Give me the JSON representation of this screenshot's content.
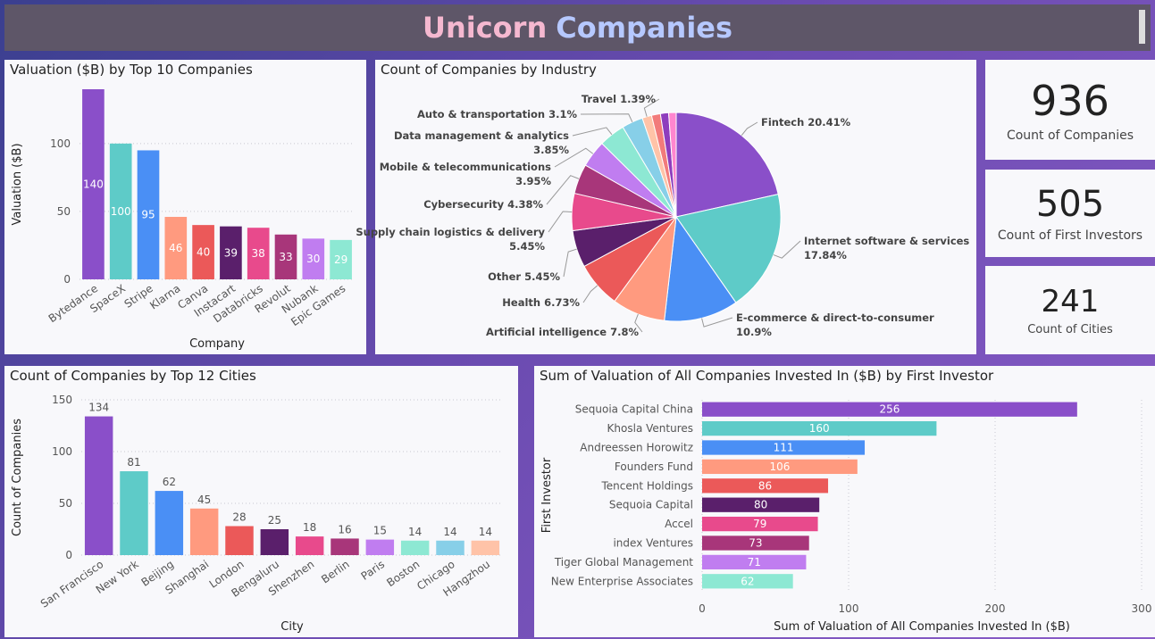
{
  "header": {
    "title_part1": "Unicorn",
    "title_part2": "Companies"
  },
  "kpis": [
    {
      "value": "936",
      "label": "Count of Companies"
    },
    {
      "value": "505",
      "label": "Count of First Investors"
    },
    {
      "value": "241",
      "label": "Count of Cities"
    }
  ],
  "chart_data": [
    {
      "type": "bar",
      "title": "Valuation ($B) by Top 10 Companies",
      "xlabel": "Company",
      "ylabel": "Valuation ($B)",
      "ylim": [
        0,
        140
      ],
      "yticks": [
        0,
        50,
        100
      ],
      "categories": [
        "Bytedance",
        "SpaceX",
        "Stripe",
        "Klarna",
        "Canva",
        "Instacart",
        "Databricks",
        "Revolut",
        "Nubank",
        "Epic Games"
      ],
      "values": [
        140,
        100,
        95,
        46,
        40,
        39,
        38,
        33,
        30,
        29
      ],
      "colors": [
        "#8a4fc9",
        "#5ecbc8",
        "#4a8ff5",
        "#ff9a7f",
        "#eb5959",
        "#5a1f6b",
        "#e84a8c",
        "#a8367a",
        "#c07df0",
        "#8de8d3"
      ],
      "grid": true
    },
    {
      "type": "pie",
      "title": "Count of Companies by Industry",
      "labels": [
        "Fintech 20.41%",
        "Internet software & services 17.84%",
        "E-commerce & direct-to-consumer 10.9%",
        "Artificial intelligence 7.8%",
        "Health 6.73%",
        "Other 5.45%",
        "Supply chain logistics & delivery 5.45%",
        "Cybersecurity 4.38%",
        "Mobile & telecommunications 3.95%",
        "Data management & analytics 3.85%",
        "Auto & transportation 3.1%",
        "Travel 1.39%"
      ],
      "values": [
        20.41,
        17.84,
        10.9,
        7.8,
        6.73,
        5.45,
        5.45,
        4.38,
        3.95,
        3.85,
        3.1,
        1.39,
        1.3,
        1.2,
        1.1
      ],
      "colors": [
        "#8a4fc9",
        "#5ecbc8",
        "#4a8ff5",
        "#ff9a7f",
        "#eb5959",
        "#5a1f6b",
        "#e84a8c",
        "#a8367a",
        "#c07df0",
        "#8de8d3",
        "#87cfe8",
        "#ffc3a8",
        "#f27b7b",
        "#8e3dbd",
        "#ff86cf"
      ]
    },
    {
      "type": "bar",
      "title": "Count of Companies by Top 12 Cities",
      "xlabel": "City",
      "ylabel": "Count of Companies",
      "ylim": [
        0,
        150
      ],
      "yticks": [
        0,
        50,
        100,
        150
      ],
      "categories": [
        "San Francisco",
        "New York",
        "Beijing",
        "Shanghai",
        "London",
        "Bengaluru",
        "Shenzhen",
        "Berlin",
        "Paris",
        "Boston",
        "Chicago",
        "Hangzhou"
      ],
      "values": [
        134,
        81,
        62,
        45,
        28,
        25,
        18,
        16,
        15,
        14,
        14,
        14
      ],
      "colors": [
        "#8a4fc9",
        "#5ecbc8",
        "#4a8ff5",
        "#ff9a7f",
        "#eb5959",
        "#5a1f6b",
        "#e84a8c",
        "#a8367a",
        "#c07df0",
        "#8de8d3",
        "#87cfe8",
        "#ffc3a8"
      ],
      "grid": true
    },
    {
      "type": "bar",
      "orientation": "horizontal",
      "title": "Sum of Valuation of All Companies Invested In ($B) by First Investor",
      "xlabel": "Sum of Valuation of All Companies Invested In ($B)",
      "ylabel": "First Investor",
      "xlim": [
        0,
        300
      ],
      "xticks": [
        0,
        100,
        200,
        300
      ],
      "categories": [
        "Sequoia Capital China",
        "Khosla Ventures",
        "Andreessen Horowitz",
        "Founders Fund",
        "Tencent Holdings",
        "Sequoia Capital",
        "Accel",
        "index Ventures",
        "Tiger Global Management",
        "New Enterprise Associates"
      ],
      "values": [
        256,
        160,
        111,
        106,
        86,
        80,
        79,
        73,
        71,
        62
      ],
      "colors": [
        "#8a4fc9",
        "#5ecbc8",
        "#4a8ff5",
        "#ff9a7f",
        "#eb5959",
        "#5a1f6b",
        "#e84a8c",
        "#a8367a",
        "#c07df0",
        "#8de8d3"
      ],
      "grid": true
    }
  ]
}
